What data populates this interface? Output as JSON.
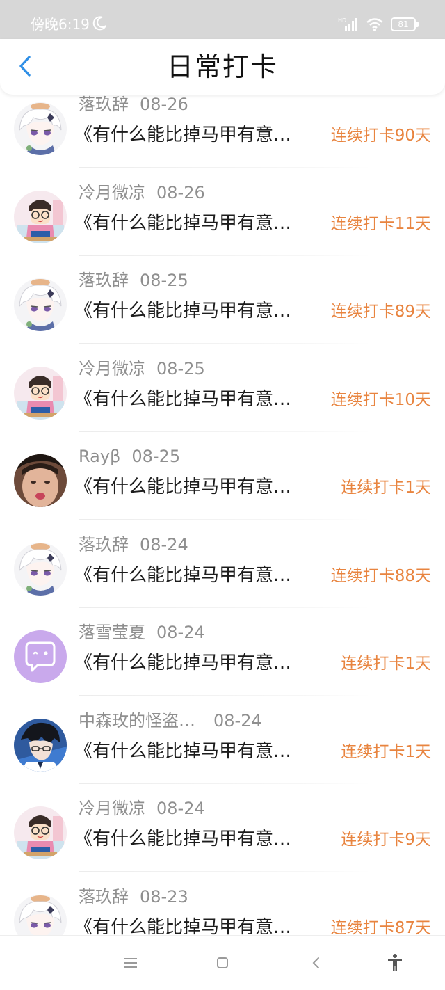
{
  "status_bar": {
    "time": "傍晚6:19",
    "hd": "HD",
    "battery": "81"
  },
  "header": {
    "title": "日常打卡"
  },
  "colors": {
    "accent": "#2f8fe6",
    "streak": "#e8843f",
    "meta": "#8f8f8f"
  },
  "items": [
    {
      "name": "落玖辞",
      "date": "08-26",
      "title": "《有什么能比掉马甲有意…",
      "streak": "连续打卡90天",
      "avatar": "anime-girl-white-hair"
    },
    {
      "name": "冷月微凉",
      "date": "08-26",
      "title": "《有什么能比掉马甲有意…",
      "streak": "连续打卡11天",
      "avatar": "conan"
    },
    {
      "name": "落玖辞",
      "date": "08-25",
      "title": "《有什么能比掉马甲有意…",
      "streak": "连续打卡89天",
      "avatar": "anime-girl-white-hair"
    },
    {
      "name": "冷月微凉",
      "date": "08-25",
      "title": "《有什么能比掉马甲有意…",
      "streak": "连续打卡10天",
      "avatar": "conan"
    },
    {
      "name": "Rayβ",
      "date": "08-25",
      "title": "《有什么能比掉马甲有意…",
      "streak": "连续打卡1天",
      "avatar": "photo-face"
    },
    {
      "name": "落玖辞",
      "date": "08-24",
      "title": "《有什么能比掉马甲有意…",
      "streak": "连续打卡88天",
      "avatar": "anime-girl-white-hair"
    },
    {
      "name": "落雪莹夏",
      "date": "08-24",
      "title": "《有什么能比掉马甲有意…",
      "streak": "连续打卡1天",
      "avatar": "purple-chat-bubble"
    },
    {
      "name": "中森玫的怪盗…",
      "date": "08-24",
      "title": "《有什么能比掉马甲有意…",
      "streak": "连续打卡1天",
      "avatar": "anime-boy-dark"
    },
    {
      "name": "冷月微凉",
      "date": "08-24",
      "title": "《有什么能比掉马甲有意…",
      "streak": "连续打卡9天",
      "avatar": "conan"
    },
    {
      "name": "落玖辞",
      "date": "08-23",
      "title": "《有什么能比掉马甲有意…",
      "streak": "连续打卡87天",
      "avatar": "anime-girl-white-hair"
    }
  ],
  "nav": [
    "menu-icon",
    "home-icon",
    "back-icon",
    "accessibility-icon"
  ]
}
